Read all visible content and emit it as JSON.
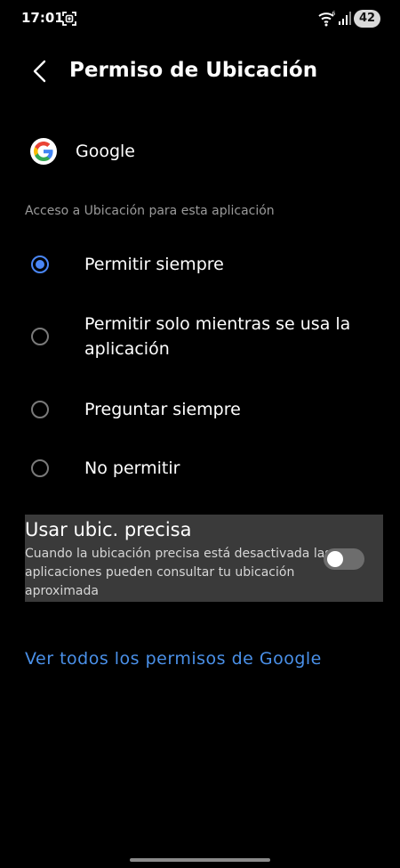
{
  "status_bar": {
    "time": "17:01",
    "battery": "42",
    "icons": [
      "screen-record-icon",
      "wifi-icon",
      "signal-icon"
    ]
  },
  "header": {
    "title": "Permiso de Ubicación",
    "back_icon": "back-arrow-icon"
  },
  "app": {
    "name": "Google",
    "icon": "google-logo-icon"
  },
  "section": {
    "label": "Acceso a Ubicación para esta aplicación"
  },
  "options": [
    {
      "label": "Permitir siempre",
      "selected": true
    },
    {
      "label": "Permitir solo mientras se usa la aplicación",
      "selected": false
    },
    {
      "label": "Preguntar siempre",
      "selected": false
    },
    {
      "label": "No permitir",
      "selected": false
    }
  ],
  "precise": {
    "title": "Usar ubic. precisa",
    "description": "Cuando la ubicación precisa está desactivada las aplicaciones pueden consultar tu ubicación aproximada",
    "enabled": false
  },
  "link": {
    "label": "Ver todos los permisos de Google"
  },
  "colors": {
    "accent": "#4a86f5",
    "link": "#4a90e8",
    "background": "#000000",
    "panel": "#3a3a3a"
  }
}
